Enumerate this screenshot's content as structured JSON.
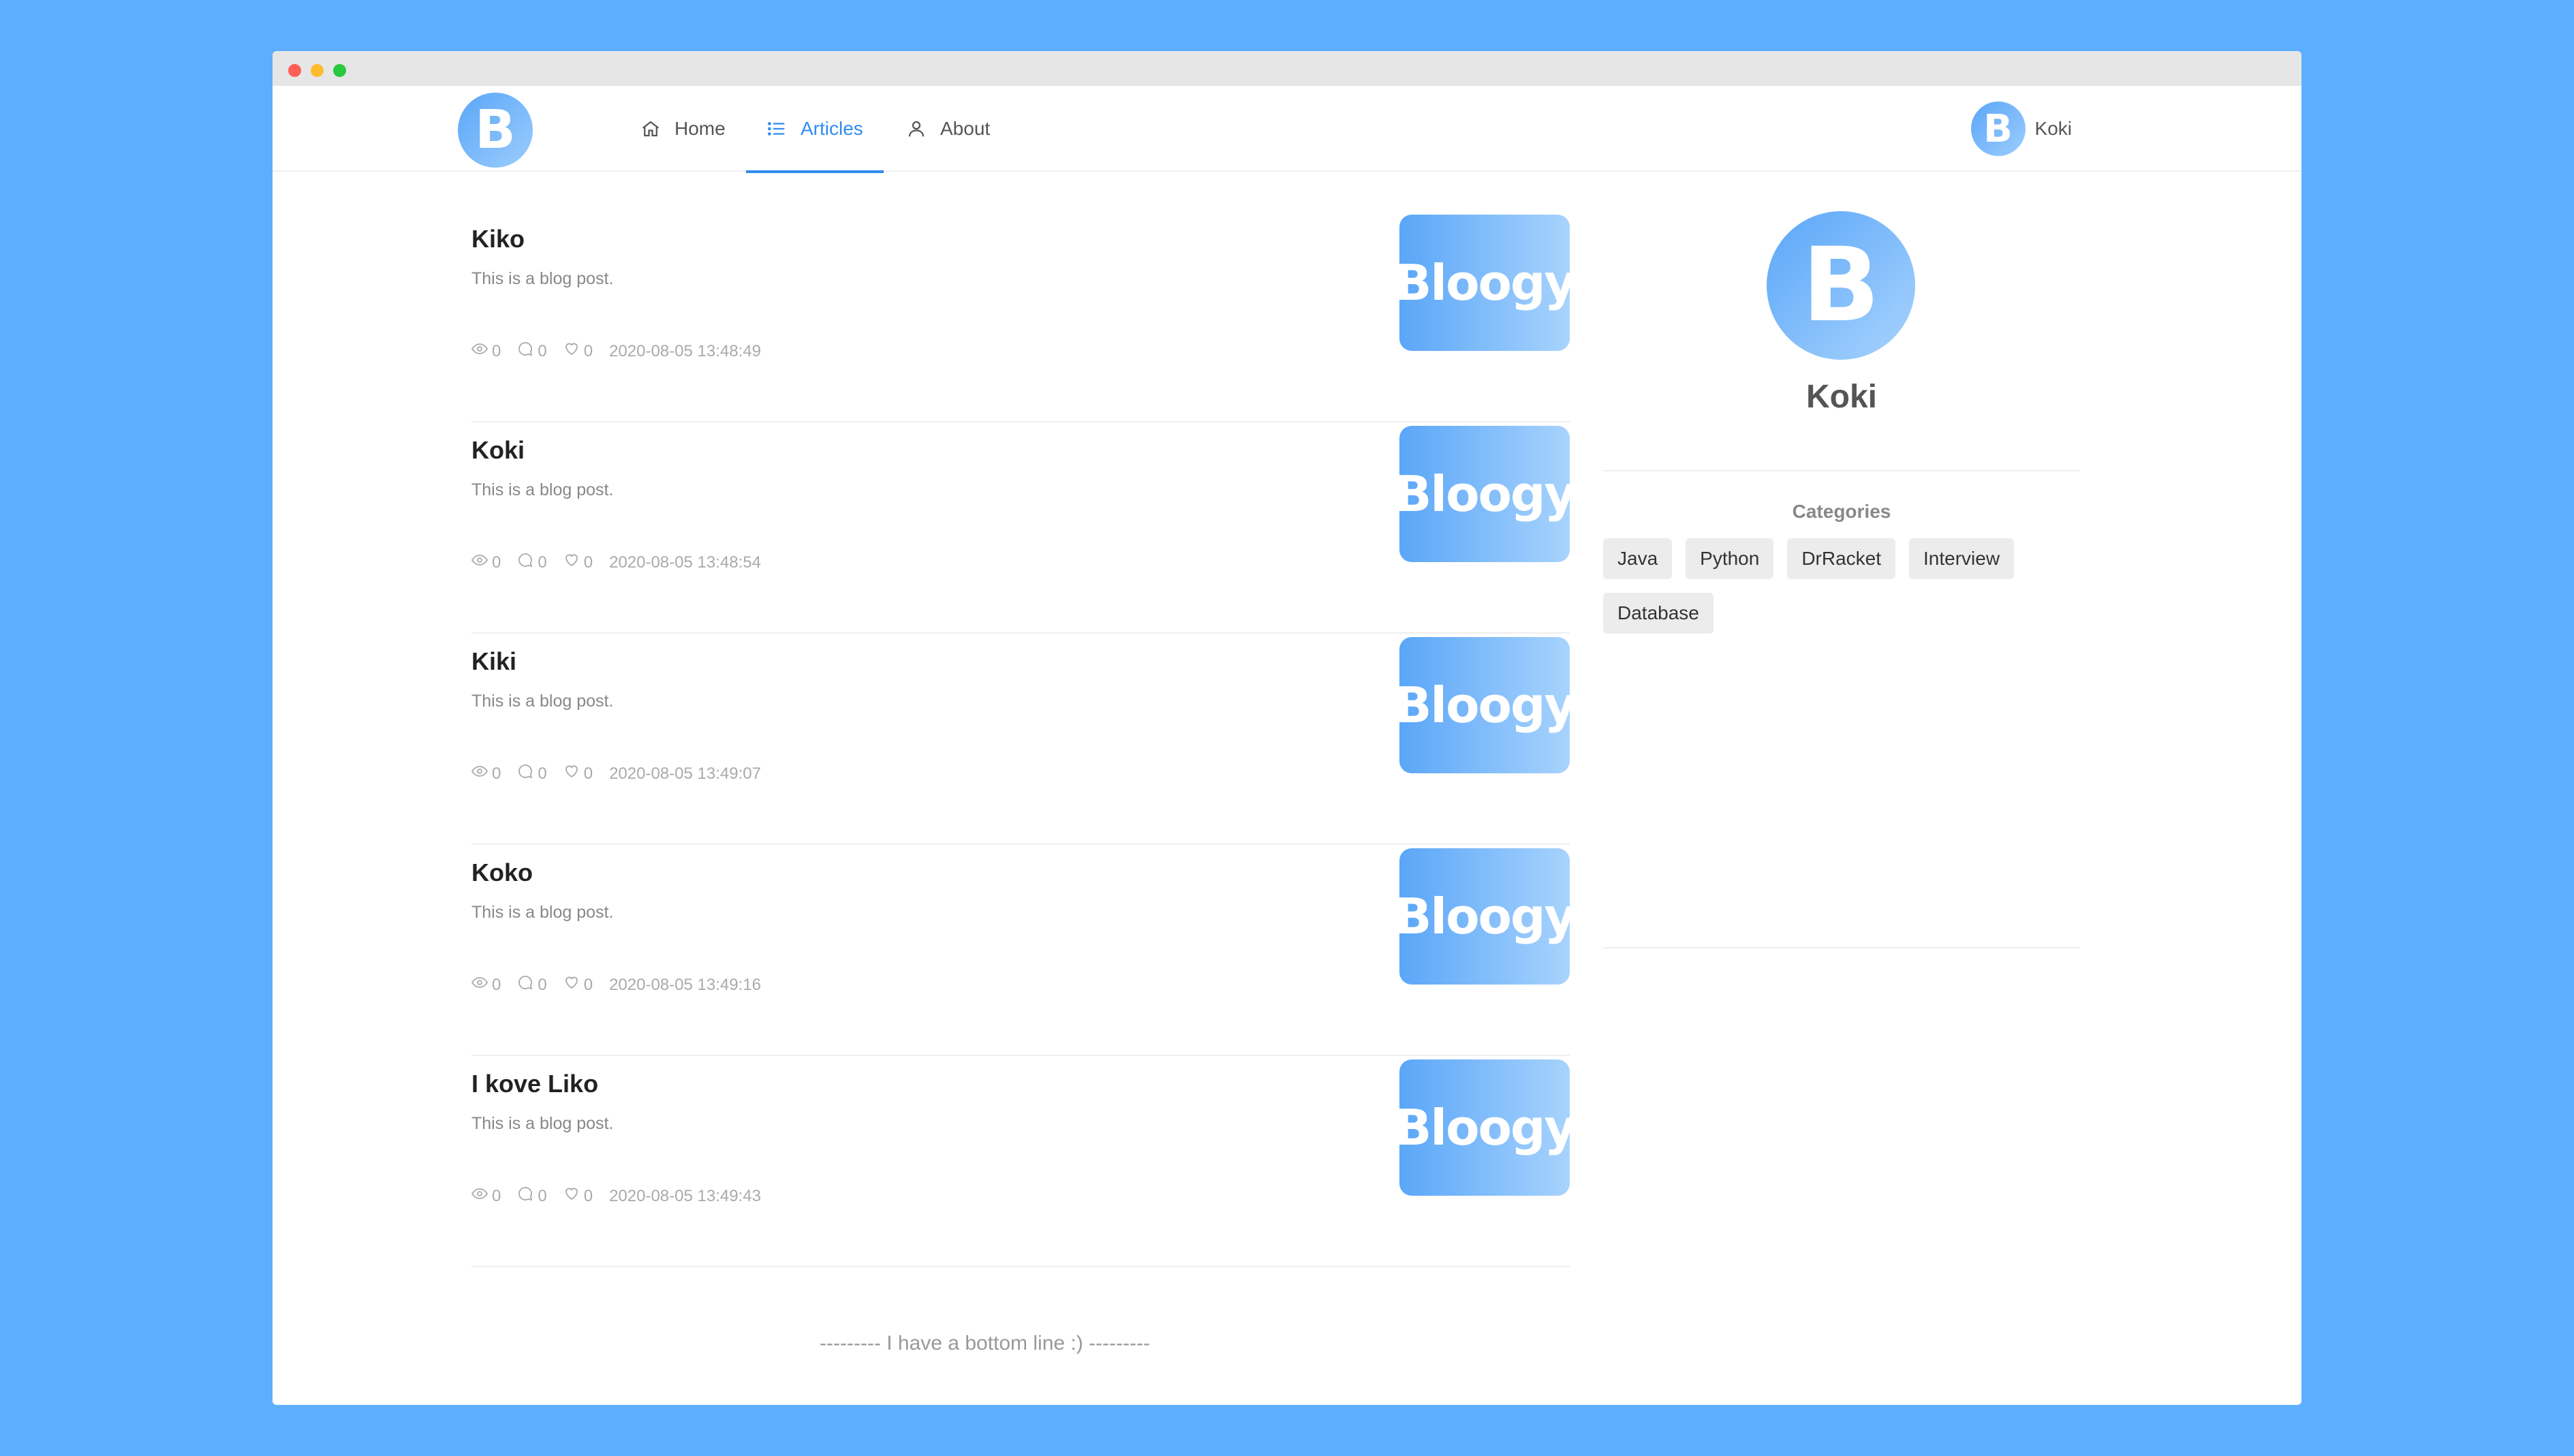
{
  "nav": {
    "logo_letter": "B",
    "items": [
      {
        "label": "Home",
        "icon": "home-icon"
      },
      {
        "label": "Articles",
        "icon": "list-icon"
      },
      {
        "label": "About",
        "icon": "user-icon"
      }
    ],
    "active": "Articles",
    "user": {
      "avatar_letter": "B",
      "name": "Koki"
    }
  },
  "articles": [
    {
      "title": "Kiko",
      "summary": "This is a blog post.",
      "views": "0",
      "comments": "0",
      "likes": "0",
      "date": "2020-08-05 13:48:49",
      "thumb_text": "Bloogy"
    },
    {
      "title": "Koki",
      "summary": "This is a blog post.",
      "views": "0",
      "comments": "0",
      "likes": "0",
      "date": "2020-08-05 13:48:54",
      "thumb_text": "Bloogy"
    },
    {
      "title": "Kiki",
      "summary": "This is a blog post.",
      "views": "0",
      "comments": "0",
      "likes": "0",
      "date": "2020-08-05 13:49:07",
      "thumb_text": "Bloogy"
    },
    {
      "title": "Koko",
      "summary": "This is a blog post.",
      "views": "0",
      "comments": "0",
      "likes": "0",
      "date": "2020-08-05 13:49:16",
      "thumb_text": "Bloogy"
    },
    {
      "title": "I kove Liko",
      "summary": "This is a blog post.",
      "views": "0",
      "comments": "0",
      "likes": "0",
      "date": "2020-08-05 13:49:43",
      "thumb_text": "Bloogy"
    }
  ],
  "bottom_line": "--------- I have a bottom line :) ---------",
  "sidebar": {
    "avatar_letter": "B",
    "name": "Koki",
    "categories_title": "Categories",
    "categories": [
      "Java",
      "Python",
      "DrRacket",
      "Interview",
      "Database"
    ]
  },
  "colors": {
    "background": "#5EAEFE",
    "accent": "#2f8cf0",
    "gradient_start": "#5aa6f8",
    "gradient_end": "#a8d3fd"
  }
}
